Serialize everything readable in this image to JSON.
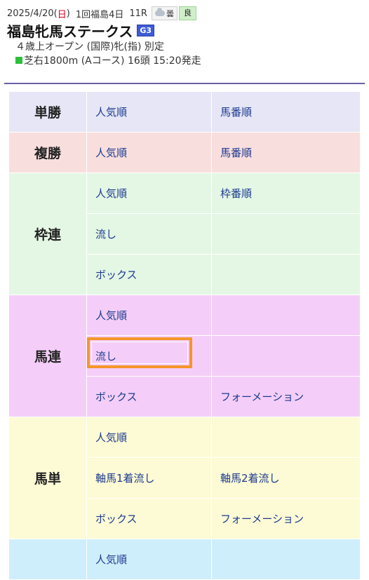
{
  "race": {
    "date_prefix": "2025/4/20(",
    "day_of_week": "日",
    "date_suffix": ")",
    "meeting": "1回福島4日",
    "race_no": "11R",
    "weather_icon": "cloud-icon",
    "weather_label": "曇",
    "track_condition": "良",
    "name": "福島牝馬ステークス",
    "grade": "G3",
    "conditions": "４歳上オープン (国際)牝(指) 別定",
    "course": "芝右1800m (Aコース) 16頭 15:20発走"
  },
  "colors": {
    "accent_divider": "#6c5fa3",
    "link": "#1d3b8f",
    "highlight": "#f5962a",
    "tansho": "#e6e6f6",
    "fukusho": "#f9dede",
    "wakuren": "#e4f7e4",
    "umaren": "#f4cef8",
    "umatan": "#fdfbd5",
    "sanren": "#cfeefb"
  },
  "bet_types": {
    "tansho": {
      "label": "単勝",
      "opt1": "人気順",
      "opt2": "馬番順"
    },
    "fukusho": {
      "label": "複勝",
      "opt1": "人気順",
      "opt2": "馬番順"
    },
    "wakuren": {
      "label": "枠連",
      "r1a": "人気順",
      "r1b": "枠番順",
      "r2a": "流し",
      "r3a": "ボックス"
    },
    "umaren": {
      "label": "馬連",
      "r1a": "人気順",
      "r2a": "流し",
      "r3a": "ボックス",
      "r3b": "フォーメーション"
    },
    "umatan": {
      "label": "馬単",
      "r1a": "人気順",
      "r2a": "軸馬1着流し",
      "r2b": "軸馬2着流し",
      "r3a": "ボックス",
      "r3b": "フォーメーション"
    },
    "sanren": {
      "r1a": "人気順"
    }
  }
}
